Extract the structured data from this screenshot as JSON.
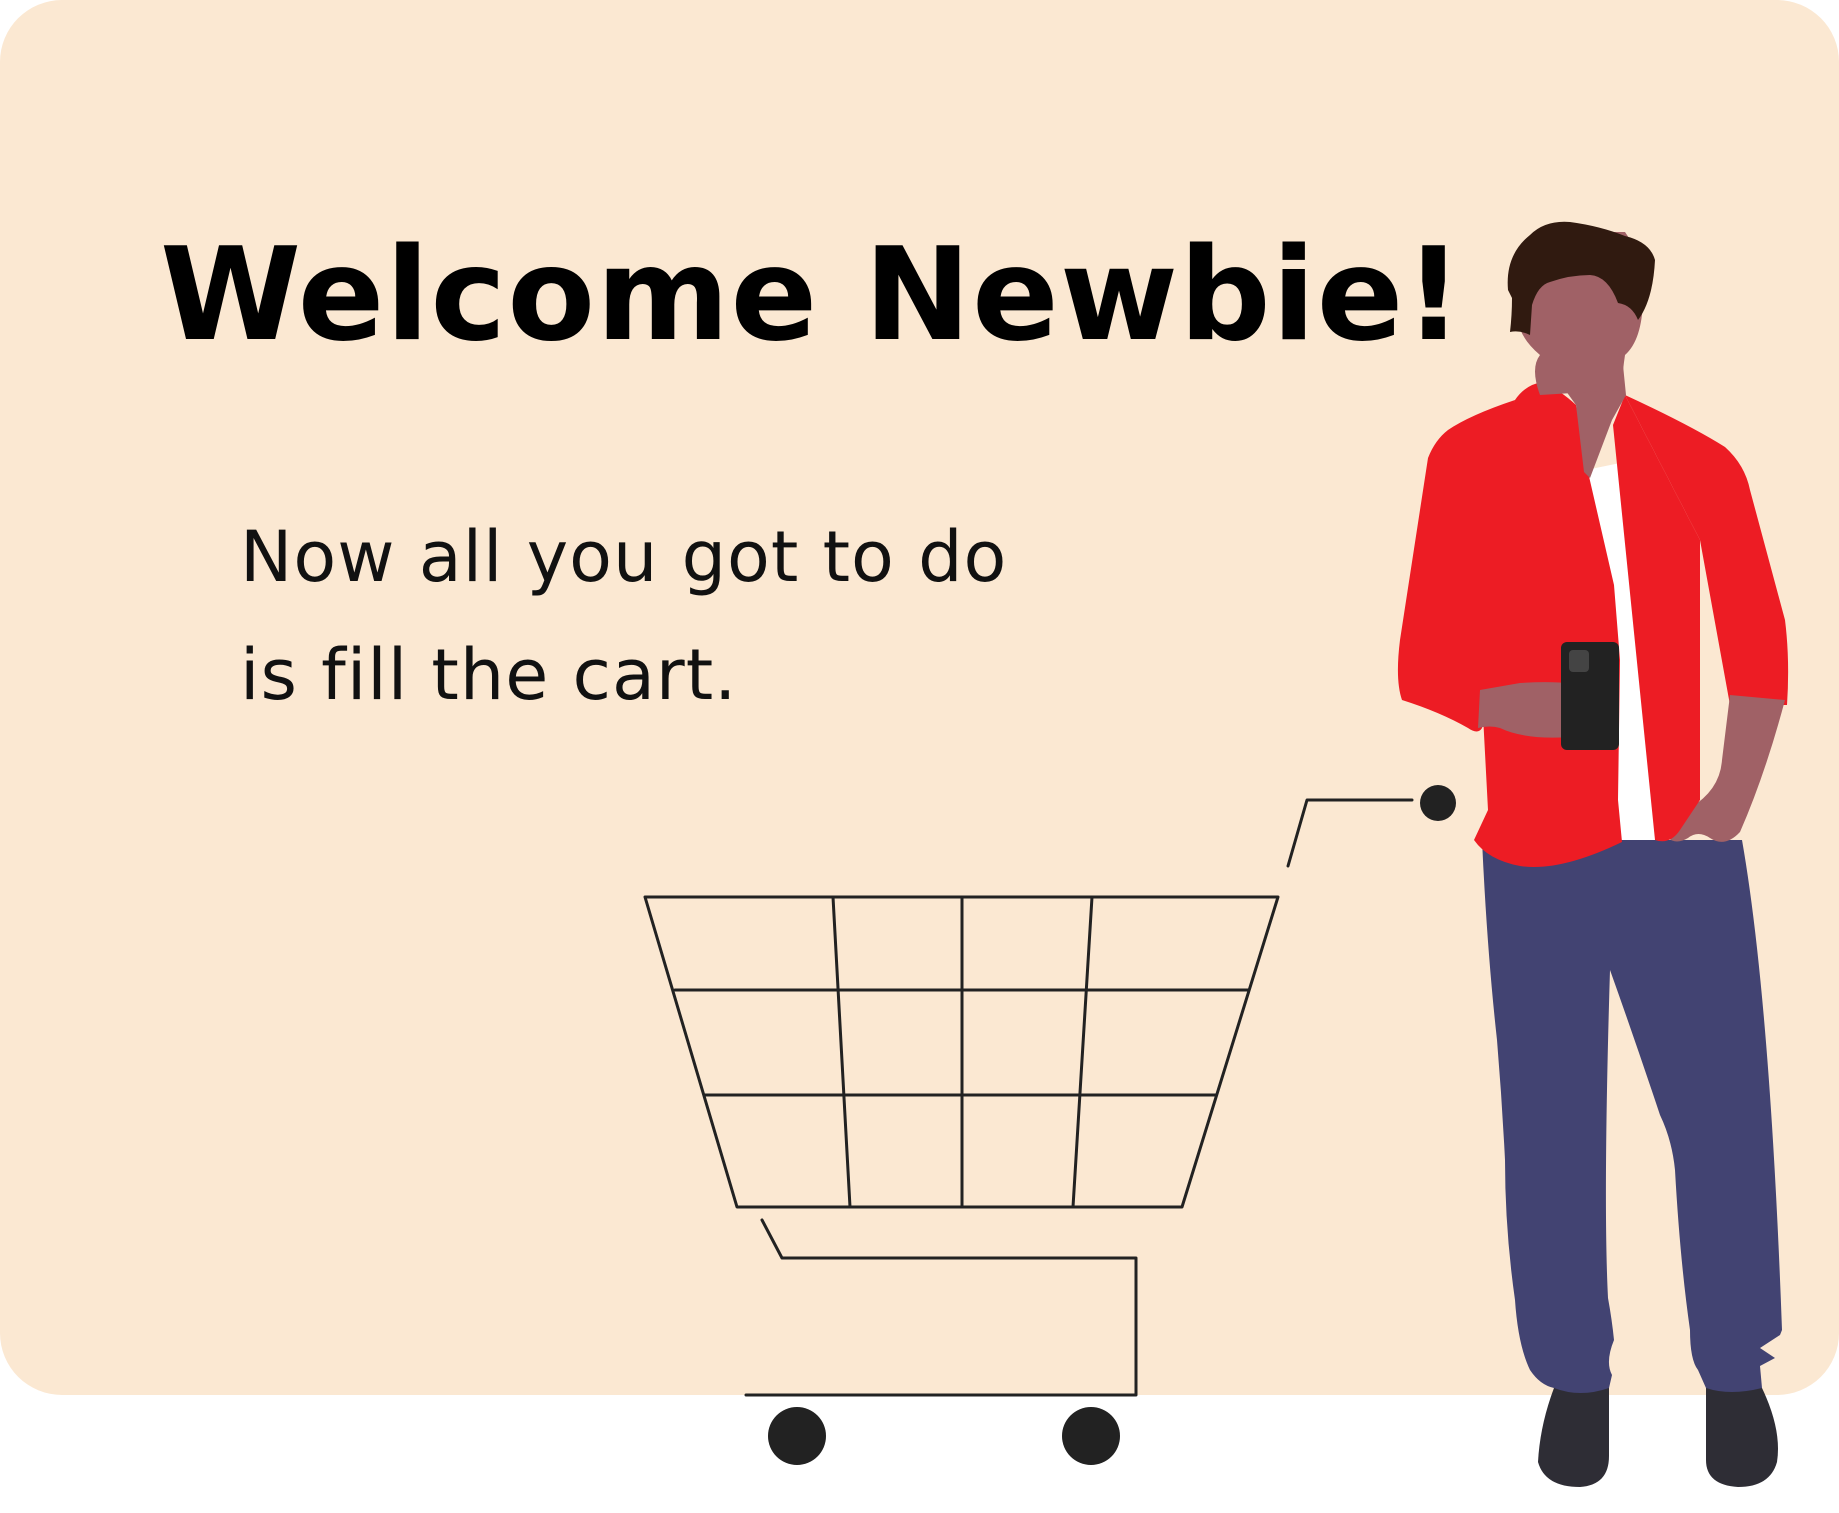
{
  "headline": "Welcome Newbie!",
  "subtext": {
    "line1": "Now all you got to do",
    "line2": "is fill the cart."
  },
  "colors": {
    "background": "#fbe8d2",
    "jacket": "#ed1c24",
    "pants": "#424372",
    "skin": "#a06166",
    "hair": "#301a10",
    "ink": "#222222"
  },
  "icons": {
    "cart": "shopping-cart-icon",
    "person": "person-with-phone-illustration"
  }
}
